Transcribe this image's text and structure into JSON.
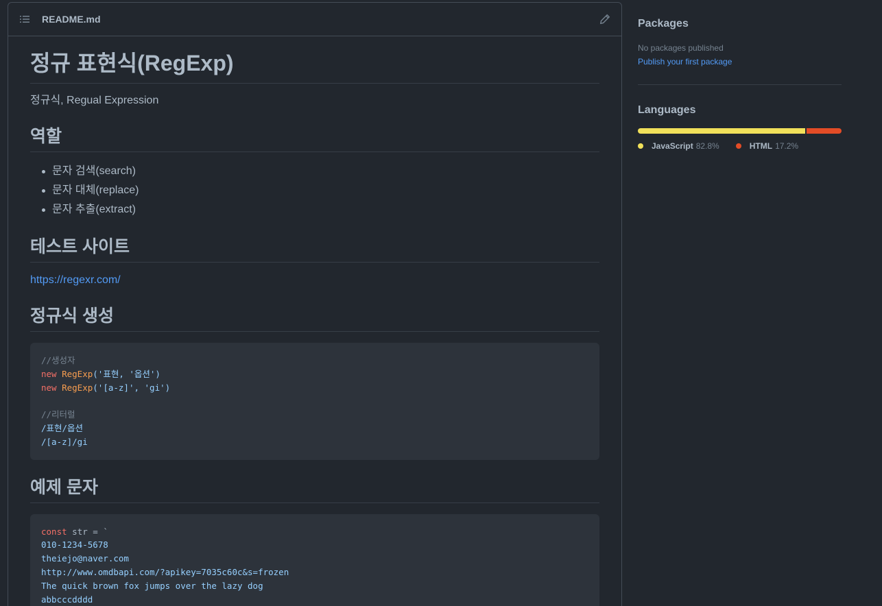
{
  "readme": {
    "filename": "README.md",
    "title": "정규 표현식(RegExp)",
    "intro": "정규식, Regual Expression",
    "role_heading": "역할",
    "role_items": [
      "문자 검색(search)",
      "문자 대체(replace)",
      "문자 추출(extract)"
    ],
    "test_site_heading": "테스트 사이트",
    "test_site_link": "https://regexr.com/",
    "create_heading": "정규식 생성",
    "code1": {
      "comment_ctor": "//생성자",
      "kw_new": "new",
      "fn_regexp": "RegExp",
      "line1_args": "('표현, '옵션')",
      "line2_args": "('[a-z]', 'gi')",
      "comment_literal": "//리터럴",
      "literal1": "/표현/옵션",
      "literal2": "/[a-z]/gi"
    },
    "example_heading": "예제 문자",
    "code2": {
      "kw_const": "const",
      "var_decl": " str = `",
      "lines": [
        "010-1234-5678",
        "theiejo@naver.com",
        "http://www.omdbapi.com/?apikey=7035c60c&s=frozen",
        "The quick brown fox jumps over the lazy dog",
        "abbcccdddd"
      ]
    }
  },
  "sidebar": {
    "packages_heading": "Packages",
    "no_packages": "No packages published",
    "publish_link": "Publish your first package",
    "languages_heading": "Languages",
    "languages": [
      {
        "name": "JavaScript",
        "percent": "82.8%",
        "value": 82.8,
        "color": "#f1e05a"
      },
      {
        "name": "HTML",
        "percent": "17.2%",
        "value": 17.2,
        "color": "#e34c26"
      }
    ]
  }
}
